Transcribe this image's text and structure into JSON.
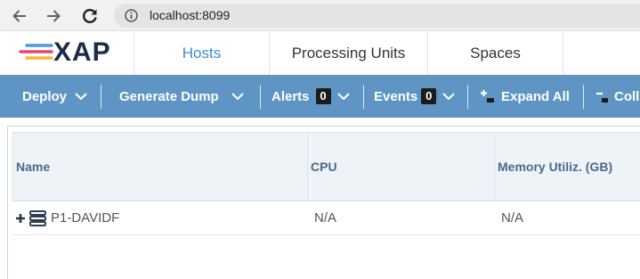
{
  "browser": {
    "url": "localhost:8099",
    "icons": {
      "back": "back-arrow-icon",
      "forward": "forward-arrow-icon",
      "reload": "reload-icon",
      "info": "info-icon"
    }
  },
  "app": {
    "logo": {
      "text": "XAP",
      "icon": "logo-stripes-icon"
    },
    "tabs": [
      {
        "label": "Hosts",
        "active": true
      },
      {
        "label": "Processing Units",
        "active": false
      },
      {
        "label": "Spaces",
        "active": false
      }
    ]
  },
  "toolbar": {
    "deploy": {
      "label": "Deploy",
      "icon": "chevron-down-icon"
    },
    "generate_dump": {
      "label": "Generate Dump",
      "icon": "chevron-down-icon"
    },
    "alerts": {
      "label": "Alerts",
      "count": 0,
      "icon": "chevron-down-icon"
    },
    "events": {
      "label": "Events",
      "count": 0,
      "icon": "chevron-down-icon"
    },
    "expand_all": {
      "label": "Expand All",
      "icon": "expand-all-icon"
    },
    "collapse_all": {
      "label": "Coll",
      "icon": "collapse-all-icon"
    }
  },
  "grid": {
    "columns": [
      "Name",
      "CPU",
      "Memory Utiliz. (GB)"
    ],
    "rows": [
      {
        "expand_icon": "plus-icon",
        "type_icon": "server-icon",
        "name": "P1-DAVIDF",
        "cpu": "N/A",
        "memory": "N/A"
      }
    ]
  },
  "theme": {
    "toolbar_bg": "#5f95c4",
    "active_tab": "#3d8bcd",
    "grid_header_bg": "#eef3f8",
    "grid_header_text": "#4a6a89",
    "logo_text": "#1d2b4a",
    "logo_stripes": [
      "#4a9be4",
      "#e8457d",
      "#f7b733"
    ],
    "badge_bg": "#1b1b1b",
    "cell_text": "#555555"
  }
}
